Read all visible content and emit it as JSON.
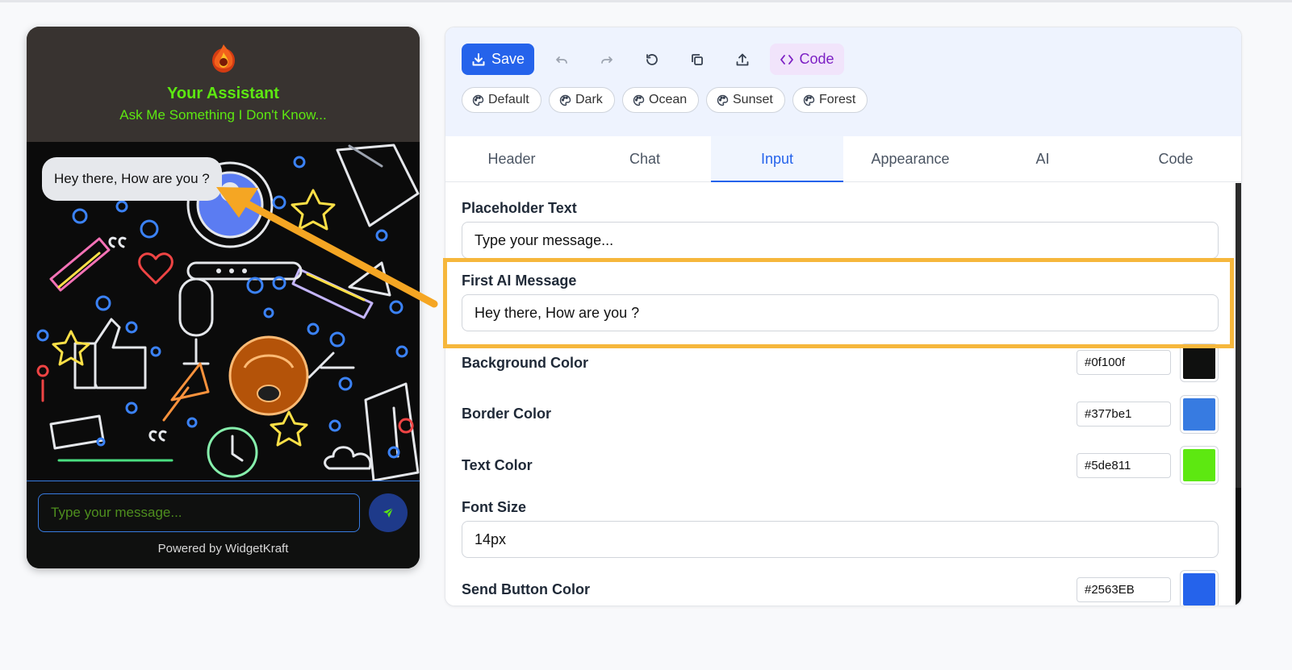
{
  "widget": {
    "title": "Your Assistant",
    "subtitle": "Ask Me Something I Don't Know...",
    "first_message": "Hey there, How are you ?",
    "input_placeholder": "Type your message...",
    "powered_by": "Powered by WidgetKraft",
    "colors": {
      "header_bg": "#383330",
      "text": "#5de811",
      "border": "#377be1",
      "background": "#0f100f"
    }
  },
  "toolbar": {
    "save_label": "Save",
    "code_label": "Code",
    "icons": [
      "undo-icon",
      "redo-icon",
      "reset-icon",
      "copy-icon",
      "upload-icon"
    ],
    "themes": [
      "Default",
      "Dark",
      "Ocean",
      "Sunset",
      "Forest"
    ]
  },
  "tabs": {
    "items": [
      "Header",
      "Chat",
      "Input",
      "Appearance",
      "AI",
      "Code"
    ],
    "active": "Input"
  },
  "input_settings": {
    "placeholder": {
      "label": "Placeholder Text",
      "value": "Type your message..."
    },
    "first_ai_message": {
      "label": "First AI Message",
      "value": "Hey there, How are you ?"
    },
    "background_color": {
      "label": "Background Color",
      "value": "#0f100f"
    },
    "border_color": {
      "label": "Border Color",
      "value": "#377be1"
    },
    "text_color": {
      "label": "Text Color",
      "value": "#5de811"
    },
    "font_size": {
      "label": "Font Size",
      "value": "14px"
    },
    "send_button_color": {
      "label": "Send Button Color",
      "value": "#2563EB"
    }
  },
  "annotation": {
    "highlight_color": "#f6b73c"
  }
}
